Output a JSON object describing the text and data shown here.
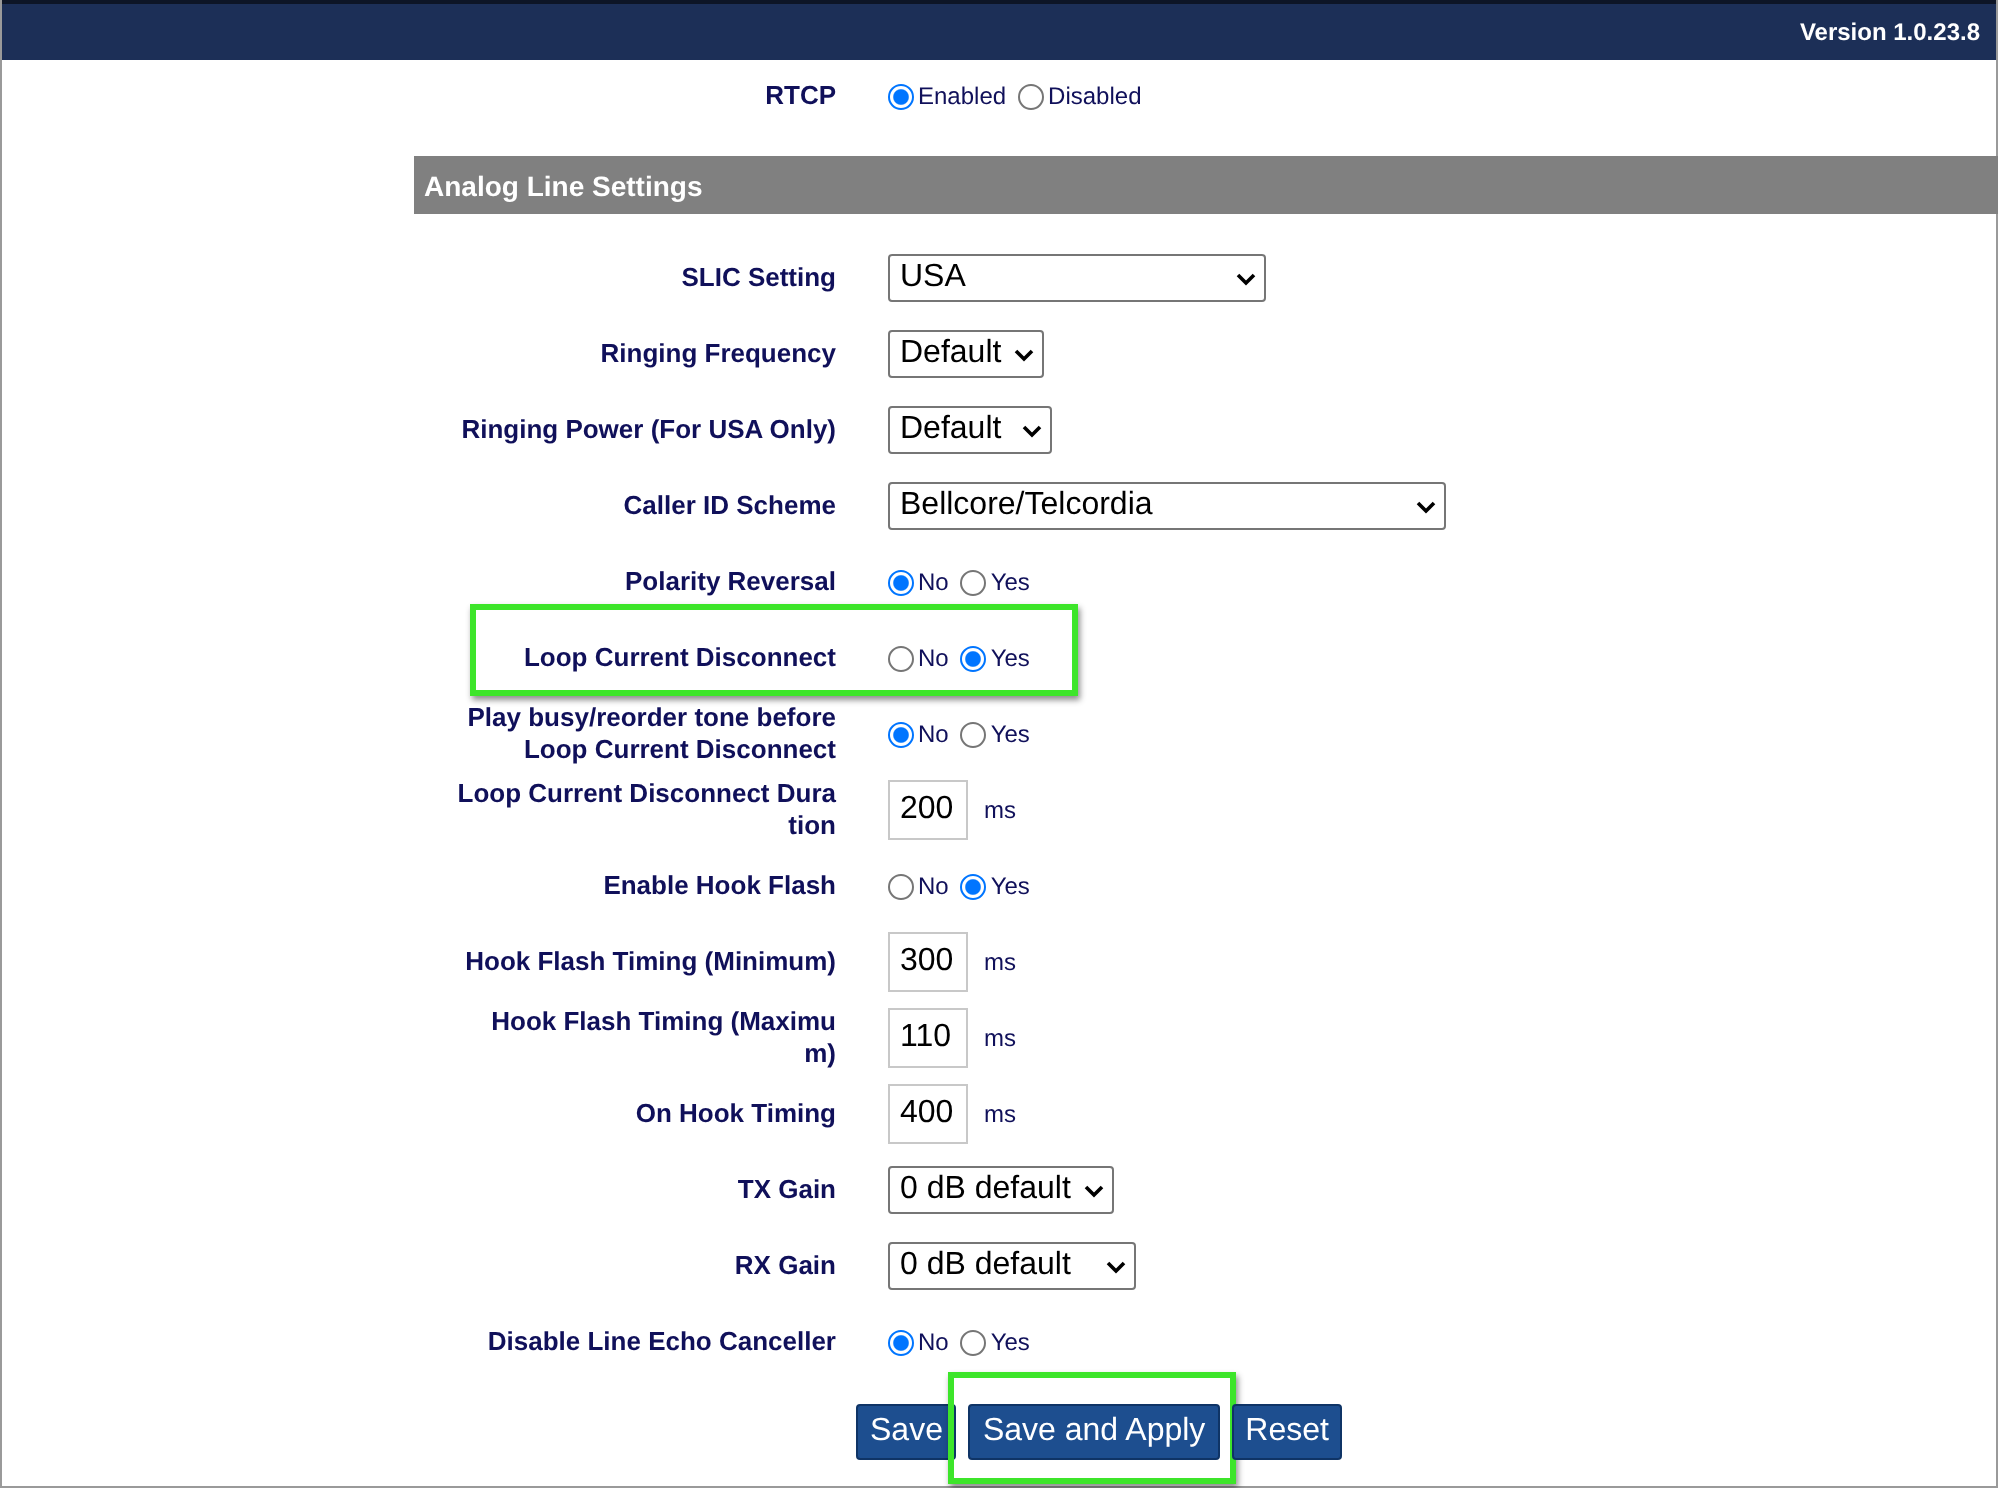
{
  "header": {
    "version": "Version 1.0.23.8"
  },
  "rtcp": {
    "label": "RTCP",
    "kind": "radio",
    "options": [
      {
        "label": "Enabled",
        "selected": true
      },
      {
        "label": "Disabled",
        "selected": false
      }
    ]
  },
  "section": {
    "title": "Analog Line Settings"
  },
  "rows": [
    {
      "label": "SLIC Setting",
      "kind": "select",
      "value": "USA"
    },
    {
      "label": "Ringing Frequency",
      "kind": "select",
      "value": "Default"
    },
    {
      "label": "Ringing Power (For USA Only)",
      "kind": "select",
      "value": "Default"
    },
    {
      "label": "Caller ID Scheme",
      "kind": "select",
      "value": "Bellcore/Telcordia"
    },
    {
      "label": "Polarity Reversal",
      "kind": "radio",
      "options": [
        {
          "label": "No",
          "selected": true
        },
        {
          "label": "Yes",
          "selected": false
        }
      ]
    },
    {
      "label": "Loop Current Disconnect",
      "kind": "radio",
      "highlighted": true,
      "options": [
        {
          "label": "No",
          "selected": false
        },
        {
          "label": "Yes",
          "selected": true
        }
      ]
    },
    {
      "label": "Play busy/reorder tone before\nLoop Current Disconnect",
      "kind": "radio",
      "options": [
        {
          "label": "No",
          "selected": true
        },
        {
          "label": "Yes",
          "selected": false
        }
      ]
    },
    {
      "label": "Loop Current Disconnect Dura\ntion",
      "kind": "number",
      "value": "200",
      "unit": "ms"
    },
    {
      "label": "Enable Hook Flash",
      "kind": "radio",
      "options": [
        {
          "label": "No",
          "selected": false
        },
        {
          "label": "Yes",
          "selected": true
        }
      ]
    },
    {
      "label": "Hook Flash Timing (Minimum)",
      "kind": "number",
      "value": "300",
      "unit": "ms"
    },
    {
      "label": "Hook Flash Timing (Maximu\nm)",
      "kind": "number",
      "value": "110",
      "unit": "ms"
    },
    {
      "label": "On Hook Timing",
      "kind": "number",
      "value": "400",
      "unit": "ms"
    },
    {
      "label": "TX Gain",
      "kind": "select",
      "value": "0 dB default"
    },
    {
      "label": "RX Gain",
      "kind": "select",
      "value": "0 dB default"
    },
    {
      "label": "Disable Line Echo Canceller",
      "kind": "radio",
      "options": [
        {
          "label": "No",
          "selected": true
        },
        {
          "label": "Yes",
          "selected": false
        }
      ]
    }
  ],
  "buttons": [
    {
      "label": "Save",
      "highlighted": false
    },
    {
      "label": "Save and Apply",
      "highlighted": true
    },
    {
      "label": "Reset",
      "highlighted": false
    }
  ]
}
